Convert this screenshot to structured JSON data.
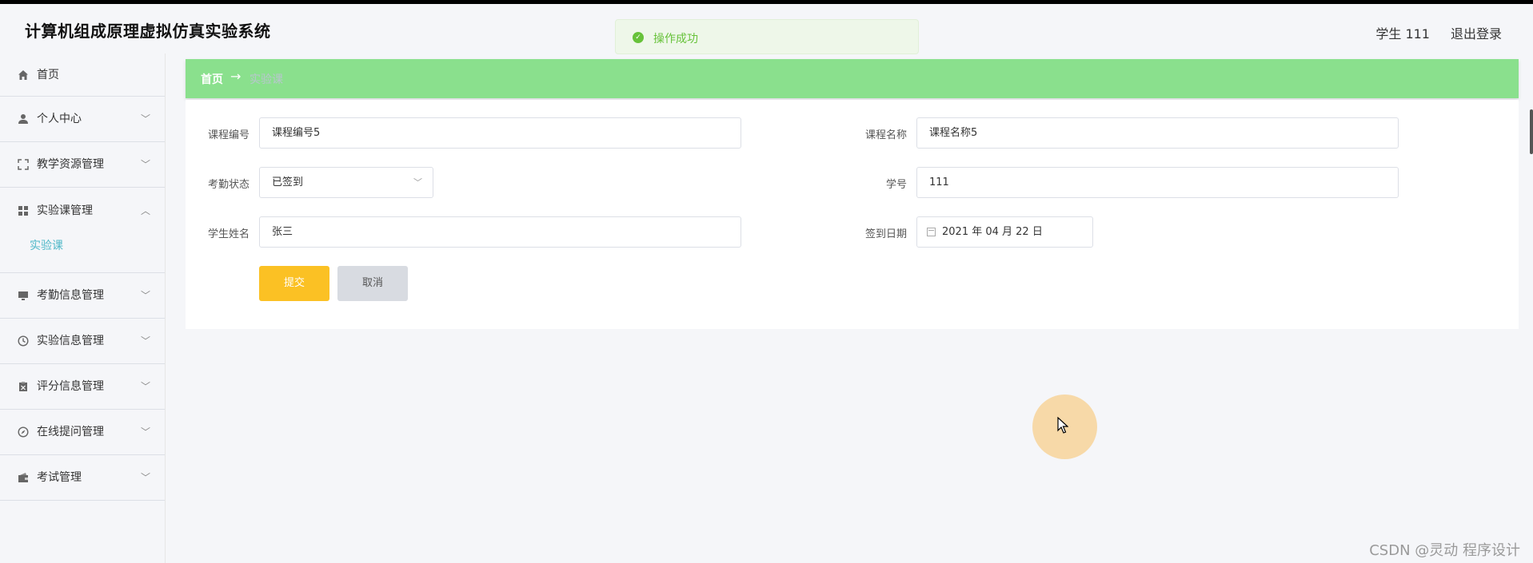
{
  "header": {
    "app_title": "计算机组成原理虚拟仿真实验系统",
    "user_label": "学生 111",
    "logout_label": "退出登录"
  },
  "toast": {
    "message": "操作成功",
    "icon": "check-circle-icon"
  },
  "sidebar": {
    "items": [
      {
        "label": "首页",
        "icon": "home-icon"
      },
      {
        "label": "个人中心",
        "icon": "user-icon",
        "arrow": "chevron-down-icon"
      },
      {
        "label": "教学资源管理",
        "icon": "fullscreen-icon",
        "arrow": "chevron-down-icon"
      },
      {
        "label": "实验课管理",
        "icon": "grid-icon",
        "arrow": "chevron-up-icon",
        "expanded": true,
        "children": [
          {
            "label": "实验课"
          }
        ]
      },
      {
        "label": "考勤信息管理",
        "icon": "monitor-icon",
        "arrow": "chevron-down-icon"
      },
      {
        "label": "实验信息管理",
        "icon": "clock-icon",
        "arrow": "chevron-down-icon"
      },
      {
        "label": "评分信息管理",
        "icon": "clipboard-icon",
        "arrow": "chevron-down-icon"
      },
      {
        "label": "在线提问管理",
        "icon": "compass-icon",
        "arrow": "chevron-down-icon"
      },
      {
        "label": "考试管理",
        "icon": "wallet-icon",
        "arrow": "chevron-down-icon"
      }
    ]
  },
  "breadcrumb": {
    "home": "首页",
    "separator": "→",
    "current": "实验课"
  },
  "form": {
    "course_no_label": "课程编号",
    "course_no_value": "课程编号5",
    "course_name_label": "课程名称",
    "course_name_value": "课程名称5",
    "attendance_label": "考勤状态",
    "attendance_value": "已签到",
    "student_id_label": "学号",
    "student_id_value": "111",
    "student_name_label": "学生姓名",
    "student_name_value": "张三",
    "signin_date_label": "签到日期",
    "signin_date_value": "2021 年 04 月 22 日",
    "submit_label": "提交",
    "cancel_label": "取消"
  },
  "watermark": "CSDN @灵动 程序设计",
  "colors": {
    "breadcrumb_bg": "#8ae08d",
    "submit_bg": "#fbc124",
    "cancel_bg": "#d8dbe1",
    "submenu_active": "#4fb8c8",
    "toast_success": "#67c23a"
  }
}
